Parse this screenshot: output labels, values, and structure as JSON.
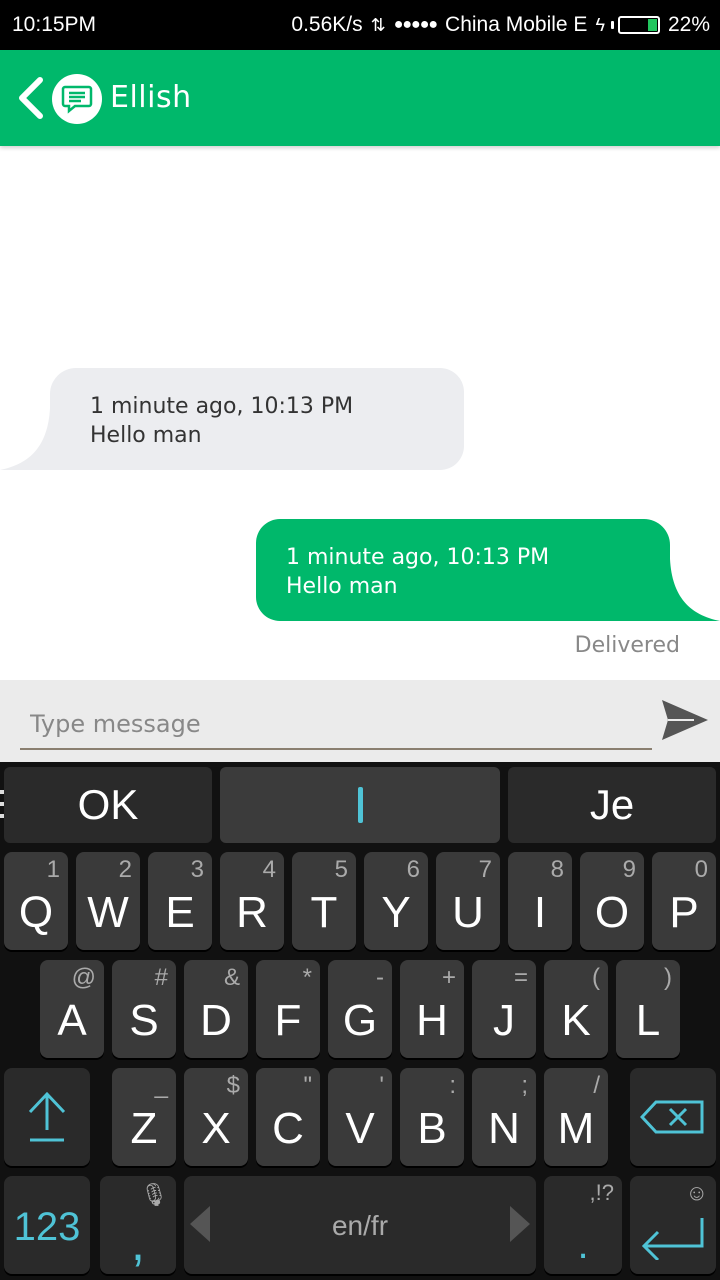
{
  "status_bar": {
    "time": "10:15PM",
    "net_speed": "0.56K/s",
    "signal": "●●●●●",
    "carrier": "China Mobile E",
    "battery": "22%"
  },
  "header": {
    "title": "Ellish"
  },
  "messages": [
    {
      "direction": "incoming",
      "timestamp": "1 minute ago, 10:13 PM",
      "text": "Hello man"
    },
    {
      "direction": "outgoing",
      "timestamp": "1 minute ago, 10:13 PM",
      "text": "Hello man"
    }
  ],
  "delivery_status": "Delivered",
  "composer": {
    "placeholder": "Type message"
  },
  "keyboard": {
    "suggestions": [
      "OK",
      "",
      "Je"
    ],
    "row1": [
      {
        "k": "Q",
        "s": "1"
      },
      {
        "k": "W",
        "s": "2"
      },
      {
        "k": "E",
        "s": "3"
      },
      {
        "k": "R",
        "s": "4"
      },
      {
        "k": "T",
        "s": "5"
      },
      {
        "k": "Y",
        "s": "6"
      },
      {
        "k": "U",
        "s": "7"
      },
      {
        "k": "I",
        "s": "8"
      },
      {
        "k": "O",
        "s": "9"
      },
      {
        "k": "P",
        "s": "0"
      }
    ],
    "row2": [
      {
        "k": "A",
        "s": "@"
      },
      {
        "k": "S",
        "s": "#"
      },
      {
        "k": "D",
        "s": "&"
      },
      {
        "k": "F",
        "s": "*"
      },
      {
        "k": "G",
        "s": "-"
      },
      {
        "k": "H",
        "s": "+"
      },
      {
        "k": "J",
        "s": "="
      },
      {
        "k": "K",
        "s": "("
      },
      {
        "k": "L",
        "s": ")"
      }
    ],
    "row3": [
      {
        "k": "Z",
        "s": "_"
      },
      {
        "k": "X",
        "s": "$"
      },
      {
        "k": "C",
        "s": "\""
      },
      {
        "k": "V",
        "s": "'"
      },
      {
        "k": "B",
        "s": ":"
      },
      {
        "k": "N",
        "s": ";"
      },
      {
        "k": "M",
        "s": "/"
      }
    ],
    "numbers_label": "123",
    "comma_label": ",",
    "space_label": "en/fr",
    "period_label": ".",
    "period_sub": ",!?",
    "accent_color": "#4fc3d6"
  },
  "colors": {
    "brand": "#00b86b",
    "incoming_bubble": "#ecedf0"
  }
}
